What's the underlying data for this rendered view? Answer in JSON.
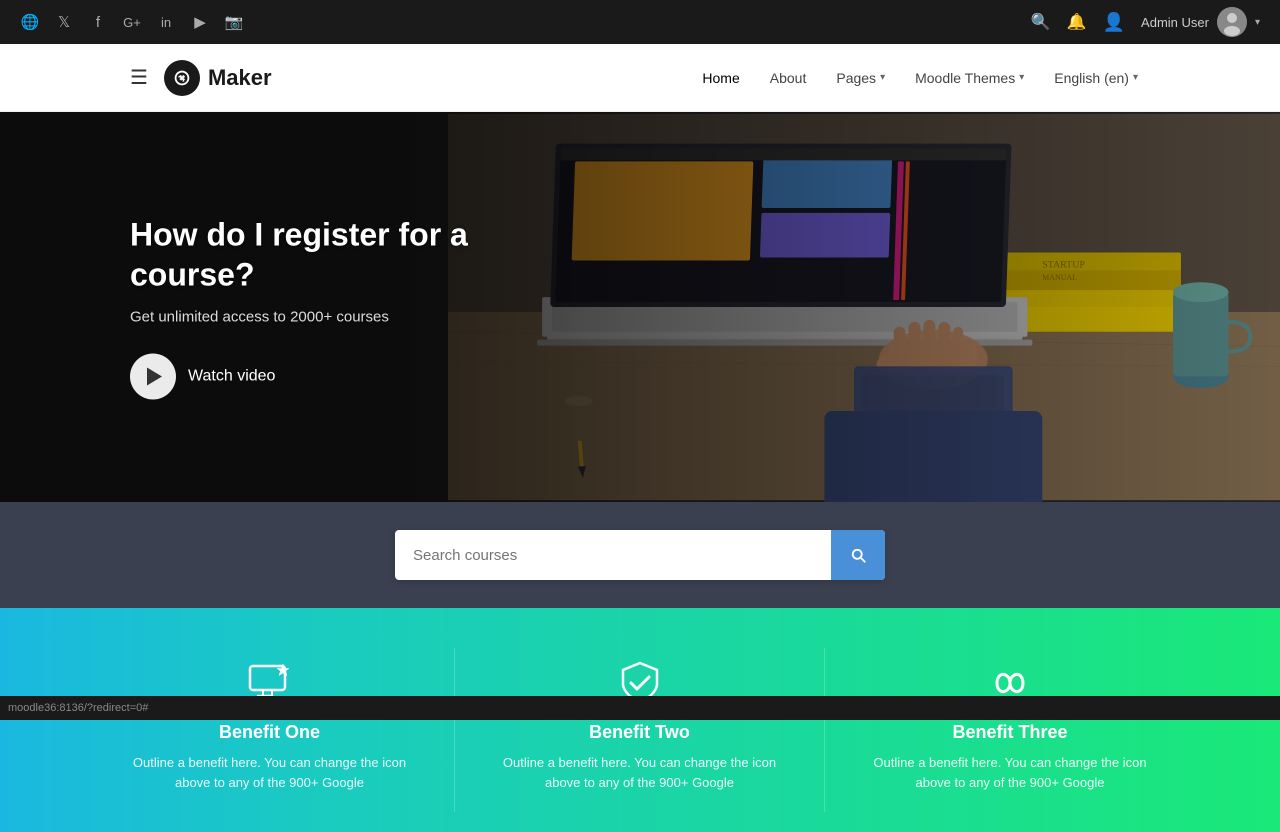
{
  "topbar": {
    "icons": [
      "globe",
      "twitter",
      "facebook",
      "google-plus",
      "linkedin",
      "youtube",
      "instagram"
    ],
    "search_icon": "🔍",
    "bell_icon": "🔔",
    "user_icon": "👤",
    "user_name": "Admin User",
    "dropdown_arrow": "▾"
  },
  "nav": {
    "logo_text": "Maker",
    "links": [
      {
        "label": "Home",
        "active": true,
        "has_caret": false
      },
      {
        "label": "About",
        "active": false,
        "has_caret": false
      },
      {
        "label": "Pages",
        "active": false,
        "has_caret": true
      },
      {
        "label": "Moodle Themes",
        "active": false,
        "has_caret": true
      },
      {
        "label": "English (en)",
        "active": false,
        "has_caret": true
      }
    ]
  },
  "hero": {
    "title": "How do I register for a course?",
    "subtitle": "Get unlimited access to 2000+ courses",
    "watch_video_label": "Watch video"
  },
  "search": {
    "placeholder": "Search courses",
    "button_aria": "Search"
  },
  "benefits": [
    {
      "id": "benefit-one",
      "icon": "monitor-star",
      "title": "Benefit One",
      "desc": "Outline a benefit here. You can change the icon above to any of the 900+ Google"
    },
    {
      "id": "benefit-two",
      "icon": "shield-check",
      "title": "Benefit Two",
      "desc": "Outline a benefit here. You can change the icon above to any of the 900+ Google"
    },
    {
      "id": "benefit-three",
      "icon": "infinity",
      "title": "Benefit Three",
      "desc": "Outline a benefit here. You can change the icon above to any of the 900+ Google"
    }
  ],
  "statusbar": {
    "url": "moodle36:8136/?redirect=0#"
  }
}
